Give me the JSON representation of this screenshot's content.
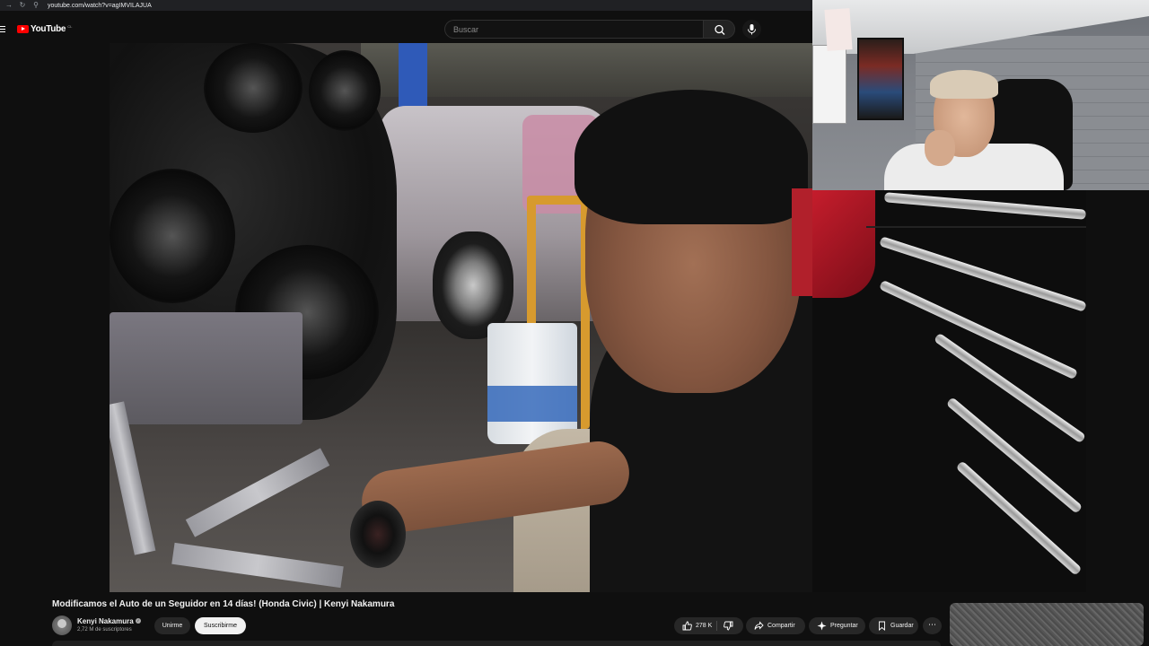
{
  "browser": {
    "url": "youtube.com/watch?v=agIMVILAJUA"
  },
  "header": {
    "logo_text": "YouTube",
    "region": "CL",
    "search_placeholder": "Buscar"
  },
  "video": {
    "title": "Modificamos el Auto de un Seguidor en 14 días! (Honda Civic) | Kenyi Nakamura"
  },
  "channel": {
    "name": "Kenyi Nakamura",
    "subscribers": "2,72 M de suscriptores",
    "join_label": "Unirme",
    "subscribe_label": "Suscribirme"
  },
  "actions": {
    "likes": "278 K",
    "share_label": "Compartir",
    "ask_label": "Preguntar",
    "save_label": "Guardar",
    "more_label": "⋯"
  },
  "icons": {
    "menu": "menu-icon",
    "search": "search-icon",
    "mic": "mic-icon",
    "like": "thumbs-up-icon",
    "dislike": "thumbs-down-icon",
    "share": "share-icon",
    "ask": "sparkle-icon",
    "save": "bookmark-icon",
    "verified": "verified-icon"
  },
  "colors": {
    "background": "#0f0f0f",
    "brand_red": "#ff0000",
    "pill_bg": "#272727",
    "subscribe_bg": "#f1f1f1"
  }
}
